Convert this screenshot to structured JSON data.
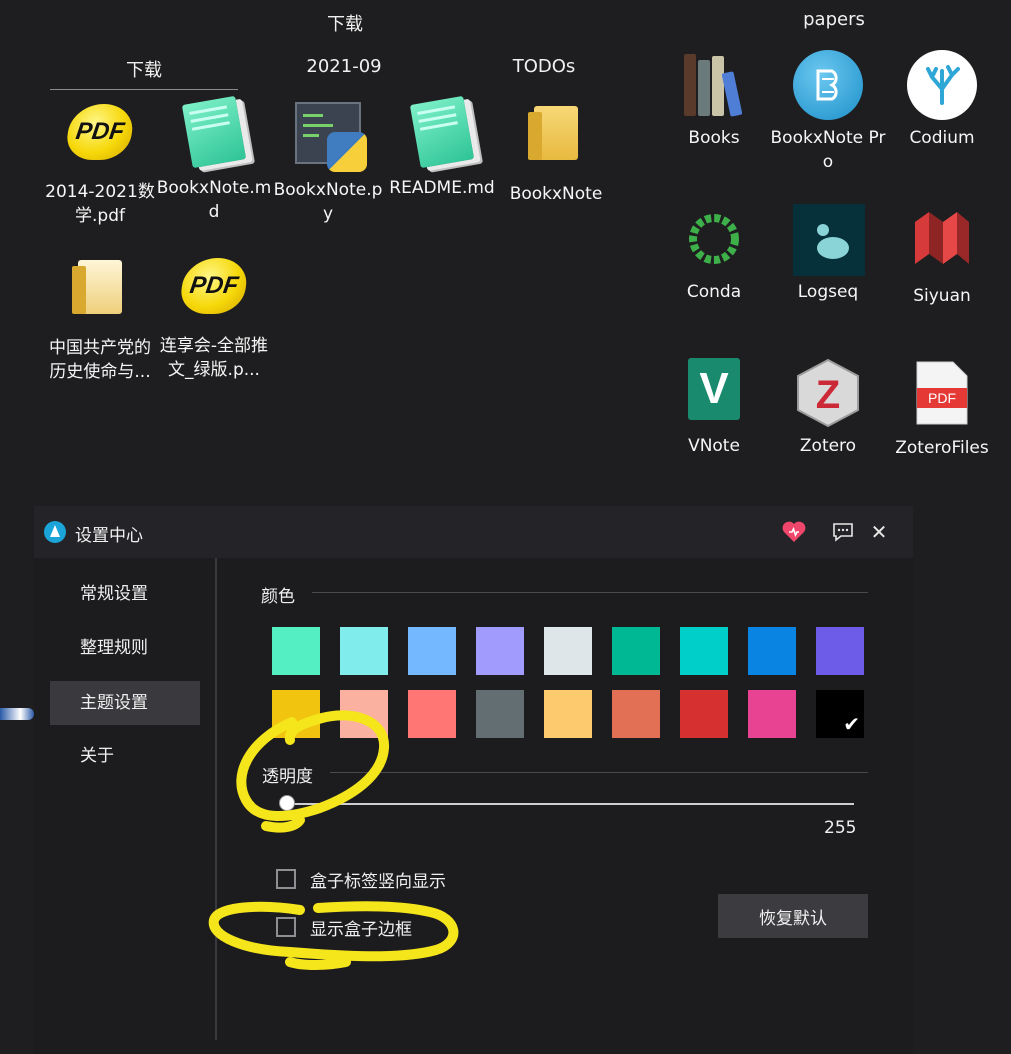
{
  "desktop": {
    "group_left_title": "下载",
    "group_right_title": "papers",
    "subfolders": [
      "下载",
      "2021-09",
      "TODOs"
    ],
    "files": [
      {
        "label": "2014-2021数学.pdf",
        "icon": "pdf-icon"
      },
      {
        "label": "BookxNote.md",
        "icon": "markdown-icon"
      },
      {
        "label": "BookxNote.py",
        "icon": "python-file-icon"
      },
      {
        "label": "README.md",
        "icon": "markdown-icon"
      },
      {
        "label": "BookxNote",
        "icon": "folder-icon"
      },
      {
        "label": "中国共产党的历史使命与...",
        "icon": "folder-documents-icon"
      },
      {
        "label": "连享会-全部推文_绿版.p...",
        "icon": "pdf-icon"
      }
    ],
    "apps": [
      {
        "label": "Books",
        "icon": "calibre-books-icon"
      },
      {
        "label": "BookxNote Pro",
        "icon": "bookxnote-icon"
      },
      {
        "label": "Codium",
        "icon": "codium-icon"
      },
      {
        "label": "Conda",
        "icon": "conda-icon"
      },
      {
        "label": "Logseq",
        "icon": "logseq-icon"
      },
      {
        "label": "Siyuan",
        "icon": "siyuan-icon"
      },
      {
        "label": "VNote",
        "icon": "vnote-icon"
      },
      {
        "label": "Zotero",
        "icon": "zotero-icon"
      },
      {
        "label": "ZoteroFiles",
        "icon": "pdf-file-icon"
      }
    ]
  },
  "window": {
    "title": "设置中心",
    "heart_icon": "heart-icon",
    "feedback_icon": "chat-icon",
    "close_label": "✕",
    "sidebar": [
      {
        "label": "常规设置",
        "active": false
      },
      {
        "label": "整理规则",
        "active": false
      },
      {
        "label": "主题设置",
        "active": true
      },
      {
        "label": "关于",
        "active": false
      }
    ],
    "color_section_label": "颜色",
    "colors_row1": [
      "#55efc4",
      "#81ecec",
      "#74b9ff",
      "#a29bfe",
      "#dfe6e9",
      "#00b894",
      "#00cec9",
      "#0984e3",
      "#6c5ce7"
    ],
    "colors_row2": [
      "#f1c40f",
      "#fab1a0",
      "#ff7675",
      "#636e72",
      "#fdcb6e",
      "#e17055",
      "#d63031",
      "#e84393",
      "#000000"
    ],
    "selected_color": "#000000",
    "opacity_label": "透明度",
    "opacity_value": "255",
    "checkbox_vertical_label": "盒子标签竖向显示",
    "checkbox_vertical_checked": false,
    "checkbox_border_label": "显示盒子边框",
    "checkbox_border_checked": false,
    "reset_button": "恢复默认",
    "annotation_color": "#f5e51b"
  }
}
